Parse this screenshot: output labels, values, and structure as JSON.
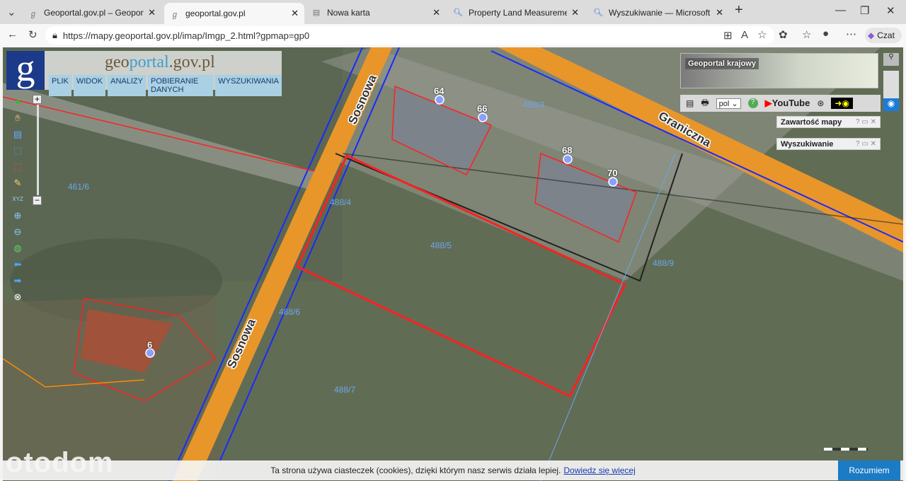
{
  "browser": {
    "tabs": [
      {
        "label": "Geoportal.gov.pl – Geoportal Infra",
        "icon": "geoportal-icon"
      },
      {
        "label": "geoportal.gov.pl",
        "icon": "geoportal-icon",
        "active": true
      },
      {
        "label": "Nowa karta",
        "icon": "newtab-icon"
      },
      {
        "label": "Property Land Measurement - Wys",
        "icon": "search-icon"
      },
      {
        "label": "Wyszukiwanie — Microsoft Bing",
        "icon": "search-icon"
      }
    ],
    "url": "https://mapy.geoportal.gov.pl/imap/Imgp_2.html?gpmap=gp0",
    "copilot_label": "Czat"
  },
  "app": {
    "brand_pre": "geo",
    "brand_mid": "portal",
    "brand_post": ".gov.pl",
    "logo_letter": "g",
    "menu": [
      "PLIK",
      "WIDOK",
      "ANALIZY",
      "POBIERANIE DANYCH",
      "WYSZUKIWANIA"
    ],
    "overview_title": "Geoportal krajowy",
    "language": "pol",
    "youtube_label": "YouTube",
    "panels": [
      {
        "title": "Zawartość mapy",
        "controls": "? ▭ ✕"
      },
      {
        "title": "Wyszukiwanie",
        "controls": "? ▭ ✕"
      }
    ],
    "zoom_in": "+",
    "zoom_out": "−"
  },
  "map": {
    "streets": [
      "Sosnowa",
      "Graniczna"
    ],
    "house_numbers": [
      "64",
      "66",
      "68",
      "70",
      "6"
    ],
    "parcels": [
      "461/6",
      "488/3",
      "488/4",
      "488/5",
      "488/6",
      "488/7",
      "488/9"
    ],
    "accent_color": "#ff2020",
    "road_color": "#e8962a"
  },
  "cookie": {
    "text": "Ta strona używa ciasteczek (cookies), dzięki którym nasz serwis działa lepiej.",
    "link": "Dowiedz się więcej",
    "accept": "Rozumiem"
  },
  "watermark": "otodom"
}
